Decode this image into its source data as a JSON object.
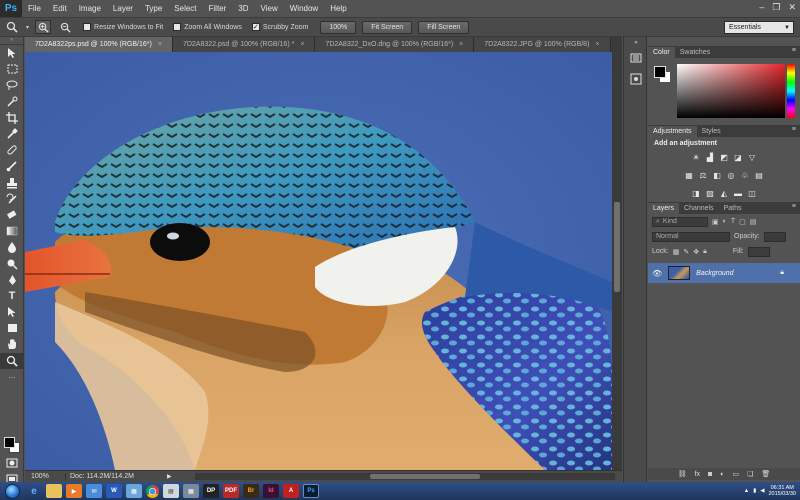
{
  "app": {
    "logo": "Ps"
  },
  "menu": [
    "File",
    "Edit",
    "Image",
    "Layer",
    "Type",
    "Select",
    "Filter",
    "3D",
    "View",
    "Window",
    "Help"
  ],
  "window_controls": {
    "minimize": "–",
    "restore": "❐",
    "close": "✕"
  },
  "options_bar": {
    "tool_icon": "zoom-icon",
    "resize_windows": {
      "label": "Resize Windows to Fit",
      "checked": false
    },
    "zoom_all": {
      "label": "Zoom All Windows",
      "checked": false
    },
    "scrubby_zoom": {
      "label": "Scrubby Zoom",
      "checked": true
    },
    "btn_100": "100%",
    "btn_fit": "Fit Screen",
    "btn_fill": "Fill Screen",
    "workspace": "Essentials"
  },
  "tabs": [
    {
      "label": "7D2A8322ps.psd @ 100% (RGB/16*)",
      "active": true
    },
    {
      "label": "7D2A8322.psd @ 100% (RGB/16) *",
      "active": false
    },
    {
      "label": "7D2A8322_DxO.dng @ 100% (RGB/16*)",
      "active": false
    },
    {
      "label": "7D2A8322.JPG @ 100% (RGB/8)",
      "active": false
    }
  ],
  "status": {
    "zoom": "100%",
    "doc": "Doc: 114.2M/114.2M"
  },
  "panels": {
    "color_tabs": [
      "Color",
      "Swatches"
    ],
    "adjust_tabs": [
      "Adjustments",
      "Styles"
    ],
    "adjust_title": "Add an adjustment",
    "layers_tabs": [
      "Layers",
      "Channels",
      "Paths"
    ],
    "kind": "Kind",
    "blend_mode": "Normal",
    "opacity_label": "Opacity:",
    "lock_label": "Lock:",
    "fill_label": "Fill:",
    "layer_name": "Background"
  },
  "taskbar": {
    "time": "06:31 AM",
    "date": "2015/03/30"
  }
}
